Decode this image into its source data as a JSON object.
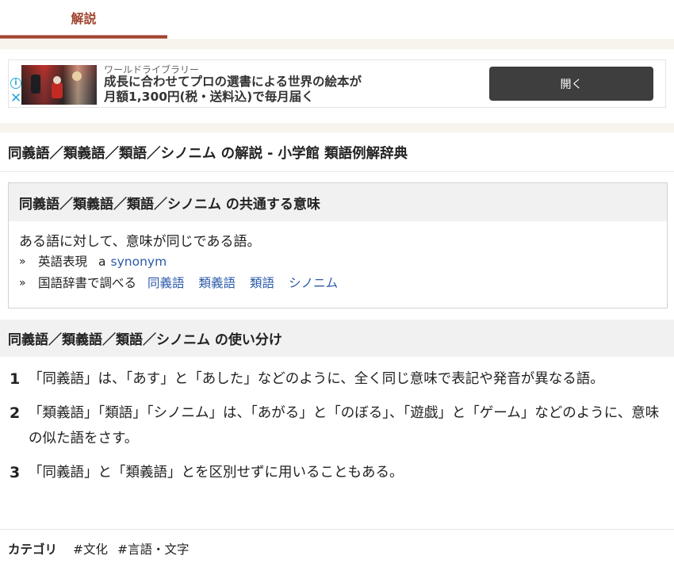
{
  "tabs": [
    {
      "label": "解説",
      "active": true
    }
  ],
  "colors": {
    "accent": "#a0432f",
    "link": "#2a5aa8",
    "band": "#f7f4ee",
    "section_bg": "#f1f1f1",
    "ad_button": "#3e3e3e",
    "ad_icon": "#29a8d6"
  },
  "ad": {
    "sponsor": "ワールドライブラリー",
    "headline_line1": "成長に合わせてプロの選書による世界の絵本が",
    "headline_line2": "月額1,300円(税・送料込)で毎月届く",
    "open_button": "開く",
    "info_icon": "info-icon",
    "close_icon": "close-icon",
    "info_glyph": "i",
    "close_glyph": "✕"
  },
  "page_title": "同義語／類義語／類語／シノニム の解説 - 小学館 類語例解辞典",
  "meaning": {
    "heading": "同義語／類義語／類語／シノニム の共通する意味",
    "definition": "ある語に対して、意味が同じである語。",
    "bullet": "»",
    "english": {
      "label": "英語表現",
      "prefix": "a",
      "word": "synonym"
    },
    "lookup": {
      "label": "国語辞書で調べる",
      "links": [
        "同義語",
        "類義語",
        "類語",
        "シノニム"
      ]
    }
  },
  "usage": {
    "heading": "同義語／類義語／類語／シノニム の使い分け",
    "items": [
      {
        "num": "1",
        "text": "「同義語」は、「あす」と「あした」などのように、全く同じ意味で表記や発音が異なる語。"
      },
      {
        "num": "2",
        "text": "「類義語」「類語」「シノニム」は、「あがる」と「のぼる」、「遊戯」と「ゲーム」などのように、意味の似た語をさす。"
      },
      {
        "num": "3",
        "text": "「同義語」と「類義語」とを区別せずに用いることもある。"
      }
    ]
  },
  "category": {
    "label": "カテゴリ",
    "tags": [
      "#文化",
      "#言語・文字"
    ]
  }
}
